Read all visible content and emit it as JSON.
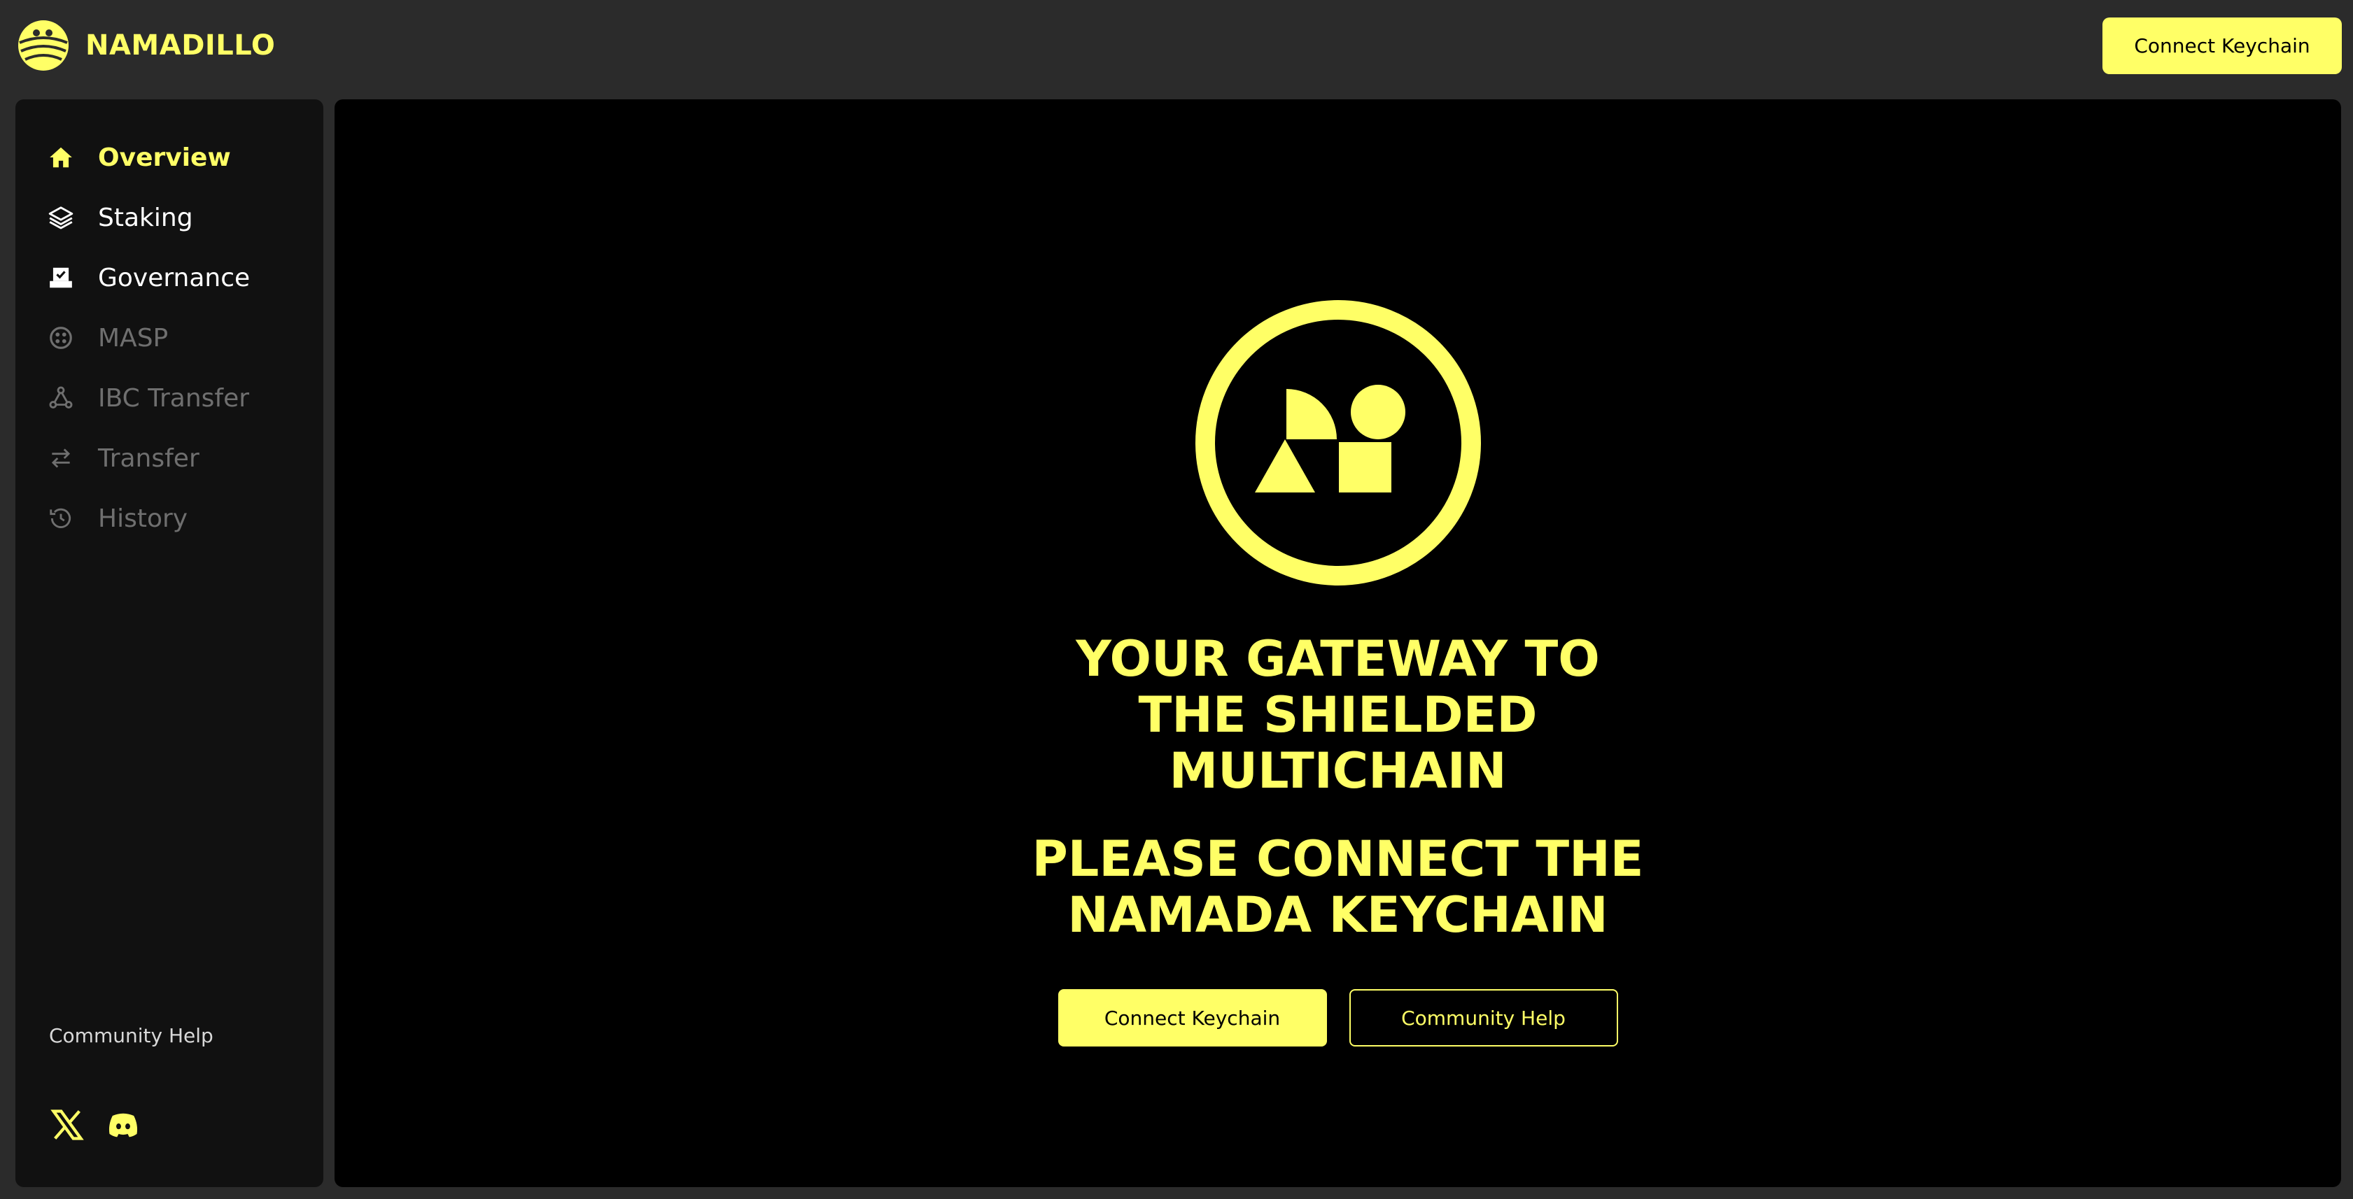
{
  "brand": {
    "name": "NAMADILLO",
    "logo_icon": "namadillo-armadillo-logo"
  },
  "header": {
    "connect_label": "Connect Keychain"
  },
  "sidebar": {
    "items": [
      {
        "label": "Overview",
        "icon": "home-icon",
        "state": "active"
      },
      {
        "label": "Staking",
        "icon": "layers-icon",
        "state": "enabled"
      },
      {
        "label": "Governance",
        "icon": "ballot-box-icon",
        "state": "enabled"
      },
      {
        "label": "MASP",
        "icon": "masp-icon",
        "state": "disabled"
      },
      {
        "label": "IBC Transfer",
        "icon": "ibc-network-icon",
        "state": "disabled"
      },
      {
        "label": "Transfer",
        "icon": "arrows-swap-icon",
        "state": "disabled"
      },
      {
        "label": "History",
        "icon": "history-clock-icon",
        "state": "disabled"
      }
    ],
    "community_help": "Community Help",
    "socials": [
      {
        "icon": "x-twitter-icon"
      },
      {
        "icon": "discord-icon"
      }
    ]
  },
  "main": {
    "hero_icon": "namada-shapes-logo",
    "headline": "YOUR GATEWAY TO THE SHIELDED MULTICHAIN",
    "subheadline": "PLEASE CONNECT THE NAMADA KEYCHAIN",
    "primary_button": "Connect Keychain",
    "secondary_button": "Community Help"
  },
  "colors": {
    "accent": "#ffff66",
    "page_bg": "#2b2b2b",
    "sidebar_bg": "#111111",
    "main_bg": "#000000",
    "disabled_text": "#6f6f6f"
  }
}
